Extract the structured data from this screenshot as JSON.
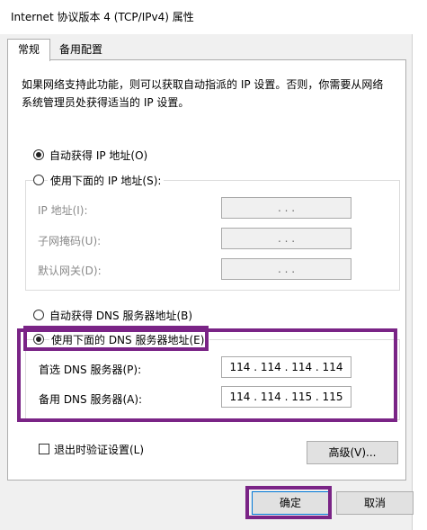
{
  "window": {
    "title": "Internet 协议版本 4 (TCP/IPv4) 属性"
  },
  "tabs": [
    {
      "label": "常规",
      "active": true
    },
    {
      "label": "备用配置",
      "active": false
    }
  ],
  "description": "如果网络支持此功能，则可以获取自动指派的 IP 设置。否则，你需要从网络系统管理员处获得适当的 IP 设置。",
  "ip": {
    "auto_label": "自动获得 IP 地址(O)",
    "auto_checked": true,
    "manual_label": "使用下面的 IP 地址(S):",
    "manual_checked": false,
    "fields": [
      {
        "label": "IP 地址(I):",
        "value": ".       .       ."
      },
      {
        "label": "子网掩码(U):",
        "value": ".       .       ."
      },
      {
        "label": "默认网关(D):",
        "value": ".       .       ."
      }
    ]
  },
  "dns": {
    "auto_label": "自动获得 DNS 服务器地址(B)",
    "auto_checked": false,
    "manual_label": "使用下面的 DNS 服务器地址(E):",
    "manual_checked": true,
    "preferred_label": "首选 DNS 服务器(P):",
    "preferred_value": "114 . 114 . 114 . 114",
    "alternate_label": "备用 DNS 服务器(A):",
    "alternate_value": "114 . 114 . 115 . 115"
  },
  "validate": {
    "label": "退出时验证设置(L)",
    "checked": false
  },
  "buttons": {
    "advanced": "高级(V)...",
    "ok": "确定",
    "cancel": "取消"
  },
  "colors": {
    "highlight": "#7a2486",
    "background": "#f0f0f0"
  }
}
